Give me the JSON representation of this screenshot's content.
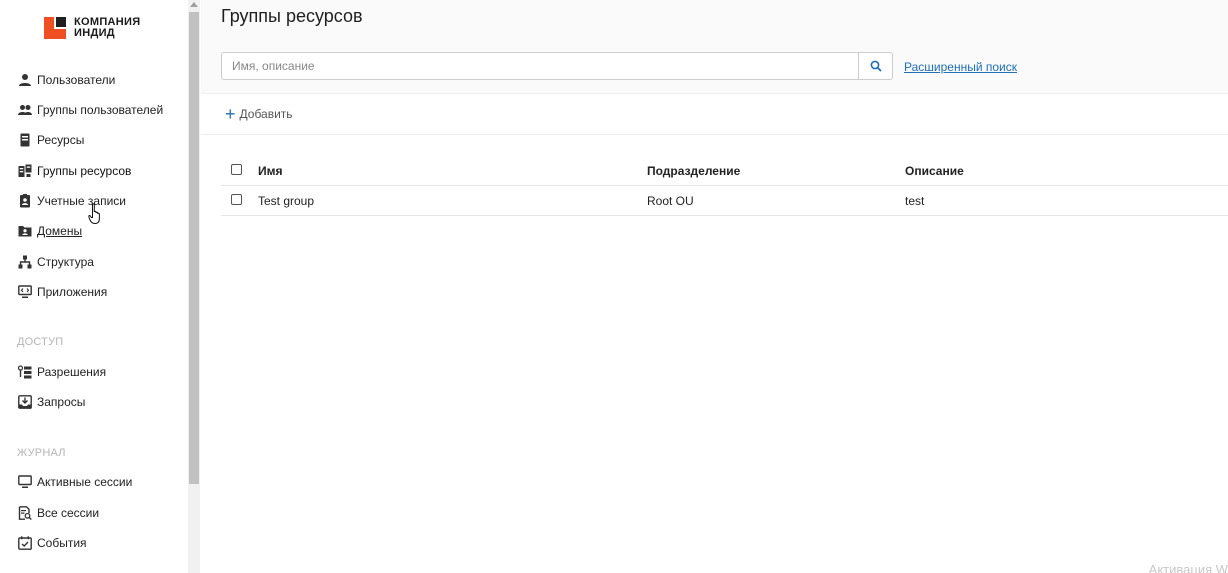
{
  "logo": {
    "line1": "КОМПАНИЯ",
    "line2": "ИНДИД"
  },
  "sidebar": {
    "items": [
      {
        "label": "Пользователи",
        "icon": "user-icon"
      },
      {
        "label": "Группы пользователей",
        "icon": "users-icon"
      },
      {
        "label": "Ресурсы",
        "icon": "server-icon"
      },
      {
        "label": "Группы ресурсов",
        "icon": "resource-groups-icon"
      },
      {
        "label": "Учетные записи",
        "icon": "account-badge-icon"
      },
      {
        "label": "Домены",
        "icon": "folder-user-icon"
      },
      {
        "label": "Структура",
        "icon": "hierarchy-icon"
      },
      {
        "label": "Приложения",
        "icon": "monitor-code-icon"
      }
    ],
    "section_access": "ДОСТУП",
    "access_items": [
      {
        "label": "Разрешения",
        "icon": "permissions-icon"
      },
      {
        "label": "Запросы",
        "icon": "inbox-download-icon"
      }
    ],
    "section_journal": "ЖУРНАЛ",
    "journal_items": [
      {
        "label": "Активные сессии",
        "icon": "monitor-icon"
      },
      {
        "label": "Все сессии",
        "icon": "doc-search-icon"
      },
      {
        "label": "События",
        "icon": "calendar-check-icon"
      }
    ]
  },
  "main": {
    "title": "Группы ресурсов",
    "search_placeholder": "Имя, описание",
    "advanced_search": "Расширенный поиск",
    "add_label": "Добавить",
    "table": {
      "headers": {
        "name": "Имя",
        "ou": "Подразделение",
        "description": "Описание"
      },
      "rows": [
        {
          "name": "Test group",
          "ou": "Root OU",
          "description": "test"
        }
      ]
    }
  },
  "watermark": "Активация W"
}
